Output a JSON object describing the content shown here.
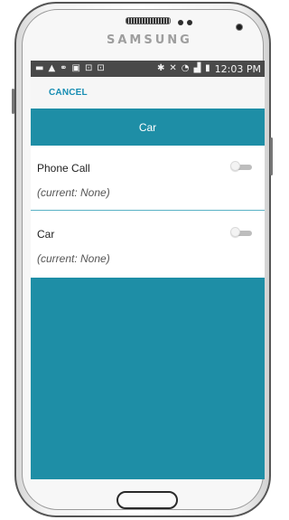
{
  "device": {
    "brand": "SAMSUNG"
  },
  "status_bar": {
    "icons": [
      "message-icon",
      "warning-icon",
      "link-icon",
      "image-icon",
      "lock-icon",
      "lock-icon",
      "bluetooth-icon",
      "mute-icon",
      "wifi-icon",
      "signal-icon",
      "battery-icon"
    ],
    "time": "12:03 PM"
  },
  "toolbar": {
    "cancel_label": "CANCEL"
  },
  "header": {
    "title": "Car"
  },
  "items": [
    {
      "title": "Phone Call",
      "subtitle": "(current: None)",
      "enabled": false
    },
    {
      "title": "Car",
      "subtitle": "(current: None)",
      "enabled": false
    }
  ],
  "colors": {
    "accent": "#1e8ea6",
    "link": "#168db3",
    "status_bar": "#494949"
  }
}
